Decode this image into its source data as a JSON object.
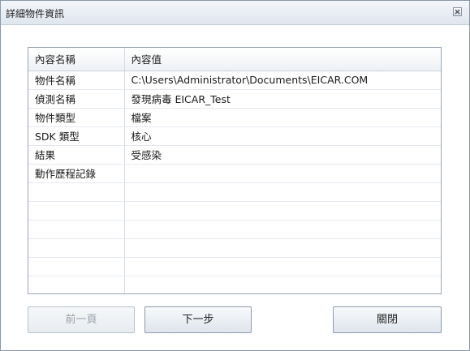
{
  "window": {
    "title": "詳細物件資訊"
  },
  "table": {
    "headers": [
      "內容名稱",
      "內容值"
    ],
    "rows": [
      [
        "物件名稱",
        "C:\\Users\\Administrator\\Documents\\EICAR.COM"
      ],
      [
        "偵測名稱",
        "發現病毒 EICAR_Test"
      ],
      [
        "物件類型",
        "檔案"
      ],
      [
        "SDK 類型",
        "核心"
      ],
      [
        "結果",
        "受感染"
      ],
      [
        "動作歷程記錄",
        ""
      ],
      [
        "",
        ""
      ],
      [
        "",
        ""
      ],
      [
        "",
        ""
      ],
      [
        "",
        ""
      ],
      [
        "",
        ""
      ],
      [
        "",
        ""
      ]
    ]
  },
  "buttons": {
    "prev_label": "前一頁",
    "next_label": "下一步",
    "close_label": "關閉"
  },
  "colors": {
    "border": "#8a98aa",
    "titlebar": "#dfe6ee",
    "disabled_text": "#9aa1aa"
  },
  "icons": {
    "close": "close-icon"
  }
}
